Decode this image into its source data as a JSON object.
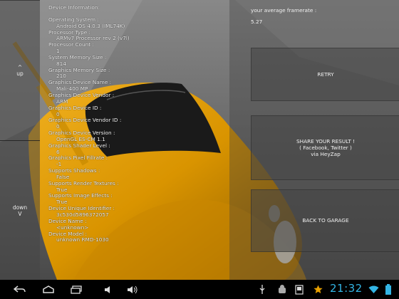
{
  "left_panel": {
    "up": {
      "arrow": "^",
      "label": "up"
    },
    "down": {
      "label": "down",
      "arrow": "V"
    }
  },
  "device_info": {
    "title": "Device Information:",
    "rows": [
      {
        "key": "Operating System :",
        "value": "Android OS 4.0.3 (IML74K)"
      },
      {
        "key": "Processor Type :",
        "value": "ARMv7 Processor rev 2 (v7l)"
      },
      {
        "key": "Processor Count :",
        "value": "1"
      },
      {
        "key": "System Memory Size :",
        "value": "814"
      },
      {
        "key": "Graphics Memory Size :",
        "value": "210"
      },
      {
        "key": "Graphics Device Name :",
        "value": "Mali-400 MP"
      },
      {
        "key": "Graphics Device Vendor :",
        "value": "ARM"
      },
      {
        "key": "Graphics Device ID :",
        "value": "0"
      },
      {
        "key": "Graphics Device Vendor ID :",
        "value": "0"
      },
      {
        "key": "Graphics Device Version :",
        "value": "OpenGL ES-CM 1.1"
      },
      {
        "key": "Graphics Shader Level :",
        "value": "6"
      },
      {
        "key": "Graphics Pixel Fillrate :",
        "value": "-1"
      },
      {
        "key": "Supports Shadows :",
        "value": "False"
      },
      {
        "key": "Supports Render Textures :",
        "value": "True"
      },
      {
        "key": "Supports Image Effects :",
        "value": "True"
      },
      {
        "key": "Device Unique Identifier :",
        "value": "3c530d5896372057"
      },
      {
        "key": "Device Name :",
        "value": "<unknown>"
      },
      {
        "key": "Device Model :",
        "value": "unknown RMD-1030"
      }
    ]
  },
  "framerate": {
    "label": "your average framerate :",
    "value": "5.27"
  },
  "buttons": {
    "retry": "RETRY",
    "share_line1": "SHARE YOUR RESULT !",
    "share_line2": "( Facebook, Twitter )",
    "share_line3": "via HeyZap",
    "garage": "BACK TO GARAGE"
  },
  "status_bar": {
    "time": "21:32"
  },
  "colors": {
    "clock": "#33b5e5",
    "car": "#e0a010"
  }
}
